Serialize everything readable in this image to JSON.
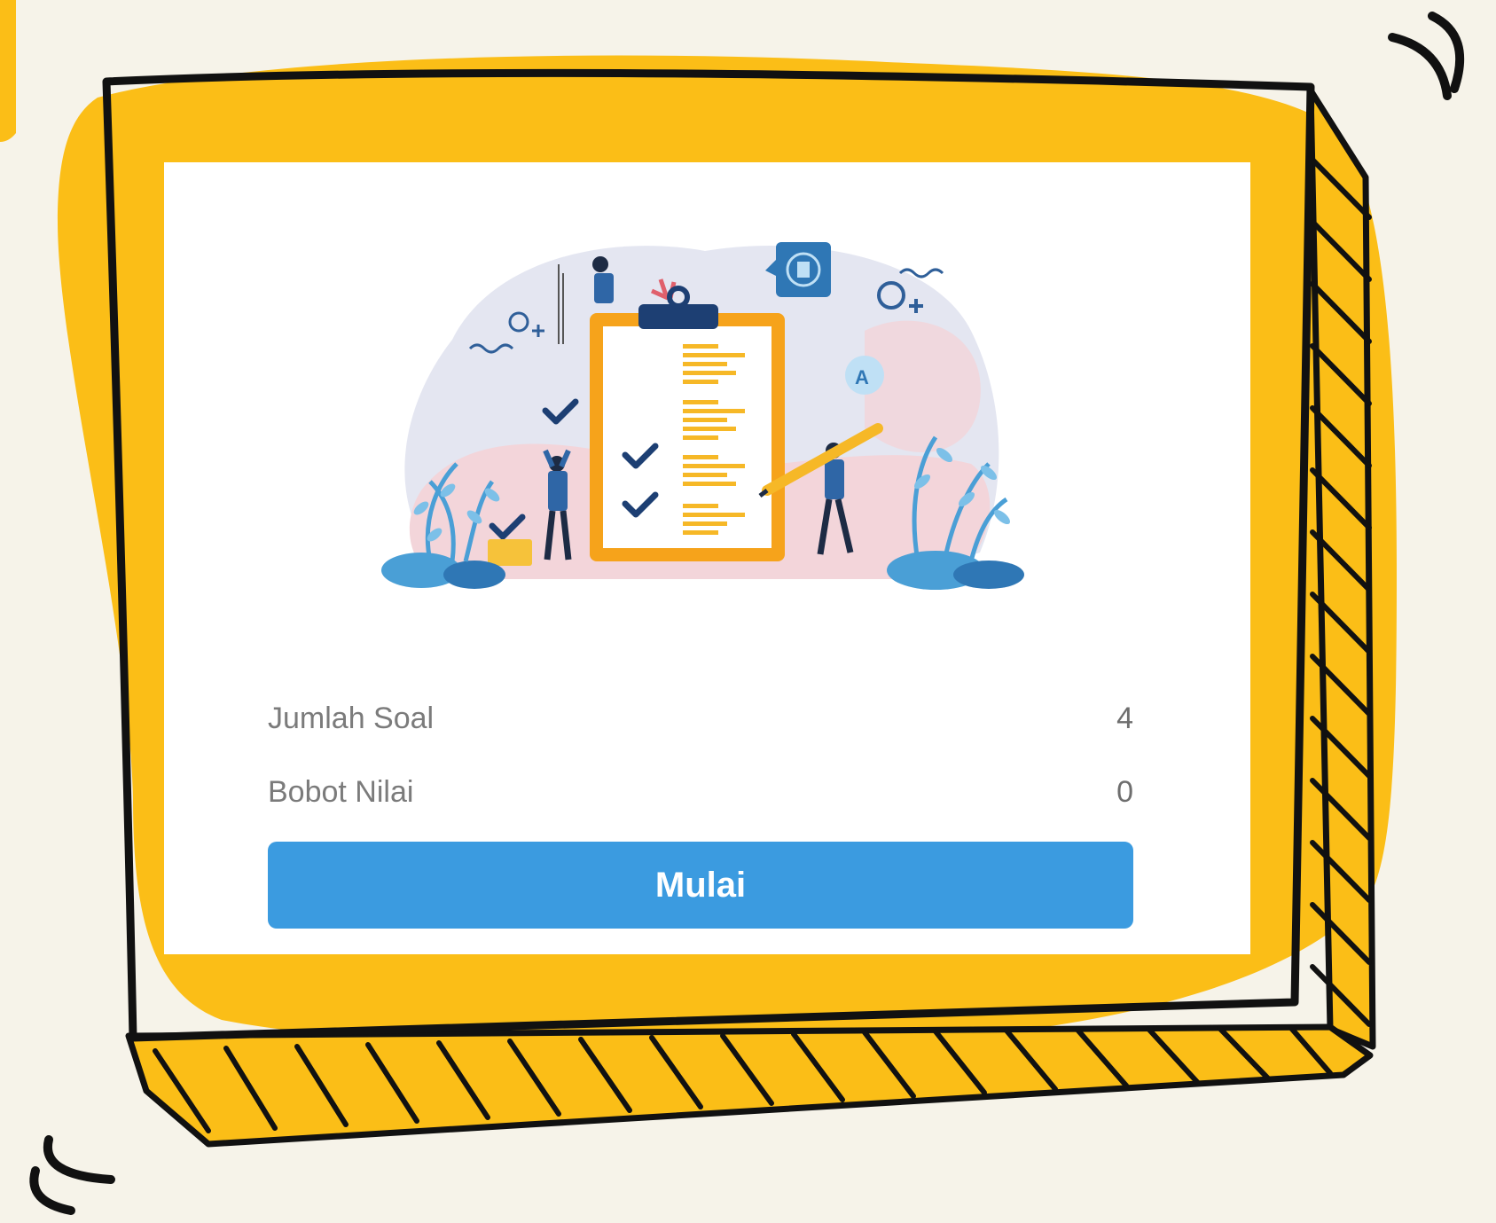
{
  "colors": {
    "background": "#f6f3e9",
    "frame_fill": "#fbbe17",
    "outline": "#111111",
    "card": "#ffffff",
    "button": "#3b9be0",
    "button_text": "#ffffff",
    "label_text": "#7b7b7b"
  },
  "illustration": {
    "icon": "quiz-checklist-illustration"
  },
  "info": {
    "question_count_label": "Jumlah Soal",
    "question_count_value": "4",
    "score_weight_label": "Bobot Nilai",
    "score_weight_value": "0"
  },
  "actions": {
    "start_label": "Mulai"
  }
}
